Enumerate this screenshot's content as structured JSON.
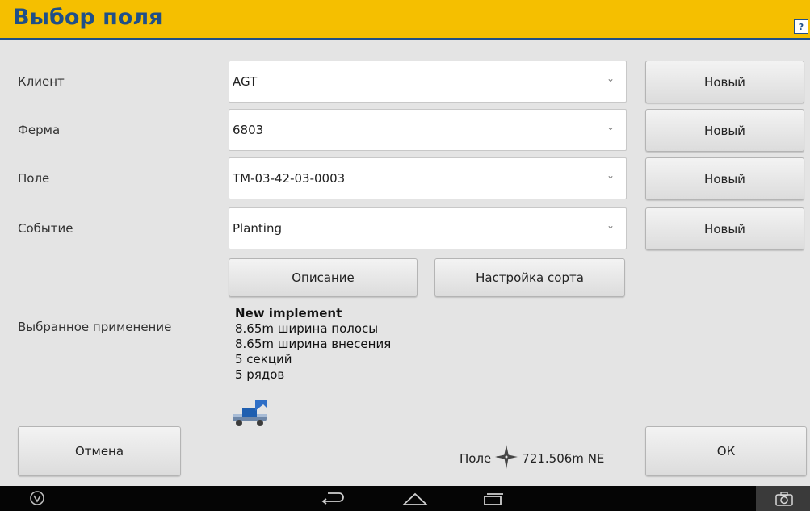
{
  "header": {
    "title": "Выбор поля",
    "help_label": "?"
  },
  "rows": [
    {
      "label": "Клиент",
      "value": "AGT",
      "button": "Новый"
    },
    {
      "label": "Ферма",
      "value": "6803",
      "button": "Новый"
    },
    {
      "label": "Поле",
      "value": "TM-03-42-03-0003",
      "button": "Новый"
    },
    {
      "label": "Событие",
      "value": "Planting",
      "button": "Новый"
    }
  ],
  "actions": {
    "description_label": "Описание",
    "variety_setup_label": "Настройка сорта"
  },
  "implement": {
    "section_label": "Выбранное применение",
    "name": "New implement",
    "lines": [
      "8.65m ширина полосы",
      "8.65m ширина внесения",
      "5 секций",
      "5 рядов"
    ]
  },
  "footer": {
    "cancel_label": "Отмена",
    "ok_label": "ОК",
    "field_label": "Поле",
    "distance": "721.506m NE"
  },
  "colors": {
    "title_bar": "#f5bf00",
    "title_text": "#1f4f88",
    "background": "#e4e4e4"
  },
  "icons": [
    "help-icon",
    "chevron-down-icon",
    "implement-icon",
    "compass-icon",
    "power-icon",
    "back-icon",
    "home-icon",
    "recents-icon",
    "camera-icon"
  ]
}
